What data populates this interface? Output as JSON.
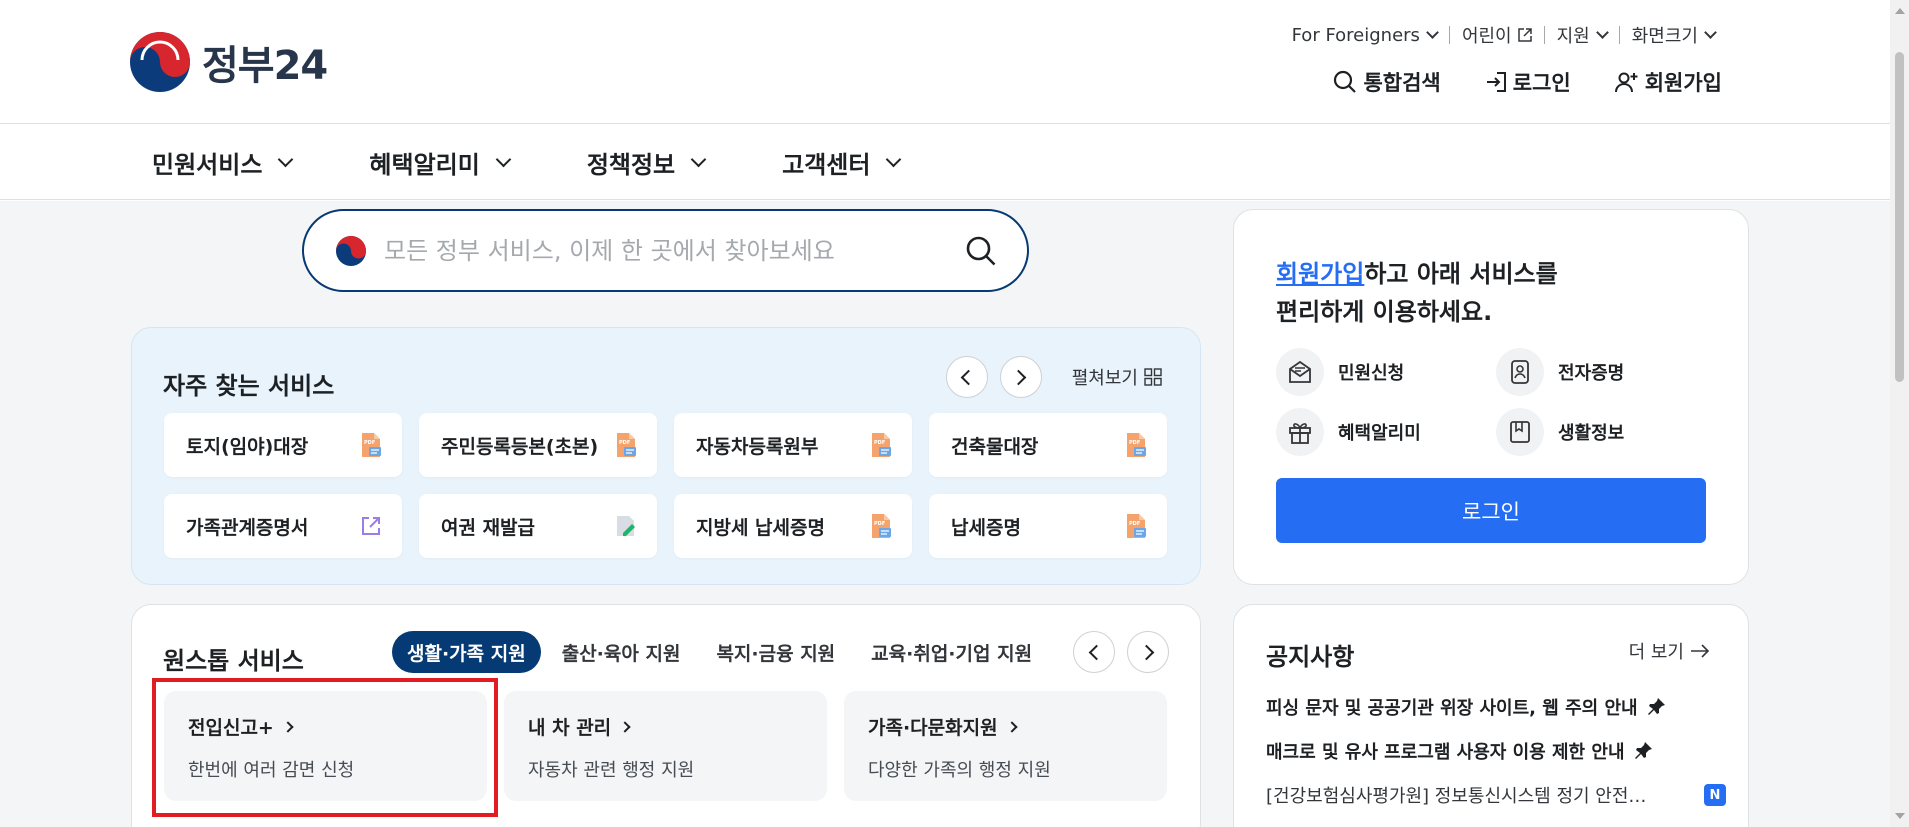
{
  "header": {
    "logo_text": "정부24",
    "util": [
      {
        "label": "For Foreigners"
      },
      {
        "label": "어린이"
      },
      {
        "label": "지원"
      },
      {
        "label": "화면크기"
      }
    ],
    "search_label": "통합검색",
    "login_label": "로그인",
    "signup_label": "회원가입"
  },
  "nav": {
    "items": [
      "민원서비스",
      "혜택알리미",
      "정책정보",
      "고객센터"
    ]
  },
  "search": {
    "placeholder": "모든 정부 서비스, 이제 한 곳에서 찾아보세요"
  },
  "frequent": {
    "title": "자주 찾는 서비스",
    "expand_label": "펼쳐보기",
    "items": [
      {
        "label": "토지(임야)대장",
        "icon": "pdf-doc-icon"
      },
      {
        "label": "주민등록등본(초본)",
        "icon": "pdf-doc-icon"
      },
      {
        "label": "자동차등록원부",
        "icon": "pdf-doc-icon"
      },
      {
        "label": "건축물대장",
        "icon": "pdf-doc-icon"
      },
      {
        "label": "가족관계증명서",
        "icon": "external-link-icon"
      },
      {
        "label": "여권 재발급",
        "icon": "edit-doc-icon"
      },
      {
        "label": "지방세 납세증명",
        "icon": "pdf-doc-icon"
      },
      {
        "label": "납세증명",
        "icon": "pdf-doc-icon"
      }
    ]
  },
  "onestop": {
    "title": "원스톱 서비스",
    "tabs": [
      "생활·가족 지원",
      "출산·육아 지원",
      "복지·금융 지원",
      "교육·취업·기업 지원"
    ],
    "active_tab": 0,
    "cards": [
      {
        "title": "전입신고+",
        "desc": "한번에 여러 감면 신청"
      },
      {
        "title": "내 차 관리",
        "desc": "자동차 관련 행정 지원"
      },
      {
        "title": "가족·다문화지원",
        "desc": "다양한 가족의 행정 지원"
      }
    ]
  },
  "login_panel": {
    "msg_link": "회원가입",
    "msg_rest1": "하고 아래 서비스를",
    "msg_line2": "편리하게 이용하세요.",
    "services": [
      {
        "label": "민원신청",
        "icon": "envelope-doc-icon"
      },
      {
        "label": "전자증명",
        "icon": "id-badge-icon"
      },
      {
        "label": "혜택알리미",
        "icon": "gift-icon"
      },
      {
        "label": "생활정보",
        "icon": "bookmark-icon"
      }
    ],
    "button_label": "로그인"
  },
  "notice": {
    "title": "공지사항",
    "more_label": "더 보기",
    "items": [
      {
        "text": "피싱 문자 및 공공기관 위장 사이트, 웹 주의 안내",
        "pinned": true
      },
      {
        "text": "매크로 및 유사 프로그램 사용자 이용 제한 안내",
        "pinned": true
      },
      {
        "text": "[건강보험심사평가원] 정보통신시스템 정기 안전…",
        "pinned": false,
        "badge": "N"
      }
    ]
  },
  "colors": {
    "primary": "#256ef4",
    "navy": "#063a74",
    "highlight": "#e11d23",
    "freq_bg": "#e8f3fb"
  }
}
